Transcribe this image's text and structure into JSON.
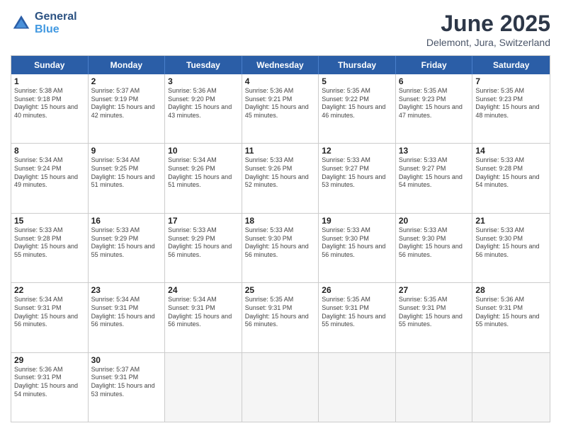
{
  "header": {
    "logo_general": "General",
    "logo_blue": "Blue",
    "month_title": "June 2025",
    "location": "Delemont, Jura, Switzerland"
  },
  "day_names": [
    "Sunday",
    "Monday",
    "Tuesday",
    "Wednesday",
    "Thursday",
    "Friday",
    "Saturday"
  ],
  "weeks": [
    [
      {
        "date": "1",
        "sunrise": "Sunrise: 5:38 AM",
        "sunset": "Sunset: 9:18 PM",
        "daylight": "Daylight: 15 hours and 40 minutes."
      },
      {
        "date": "2",
        "sunrise": "Sunrise: 5:37 AM",
        "sunset": "Sunset: 9:19 PM",
        "daylight": "Daylight: 15 hours and 42 minutes."
      },
      {
        "date": "3",
        "sunrise": "Sunrise: 5:36 AM",
        "sunset": "Sunset: 9:20 PM",
        "daylight": "Daylight: 15 hours and 43 minutes."
      },
      {
        "date": "4",
        "sunrise": "Sunrise: 5:36 AM",
        "sunset": "Sunset: 9:21 PM",
        "daylight": "Daylight: 15 hours and 45 minutes."
      },
      {
        "date": "5",
        "sunrise": "Sunrise: 5:35 AM",
        "sunset": "Sunset: 9:22 PM",
        "daylight": "Daylight: 15 hours and 46 minutes."
      },
      {
        "date": "6",
        "sunrise": "Sunrise: 5:35 AM",
        "sunset": "Sunset: 9:23 PM",
        "daylight": "Daylight: 15 hours and 47 minutes."
      },
      {
        "date": "7",
        "sunrise": "Sunrise: 5:35 AM",
        "sunset": "Sunset: 9:23 PM",
        "daylight": "Daylight: 15 hours and 48 minutes."
      }
    ],
    [
      {
        "date": "8",
        "sunrise": "Sunrise: 5:34 AM",
        "sunset": "Sunset: 9:24 PM",
        "daylight": "Daylight: 15 hours and 49 minutes."
      },
      {
        "date": "9",
        "sunrise": "Sunrise: 5:34 AM",
        "sunset": "Sunset: 9:25 PM",
        "daylight": "Daylight: 15 hours and 51 minutes."
      },
      {
        "date": "10",
        "sunrise": "Sunrise: 5:34 AM",
        "sunset": "Sunset: 9:26 PM",
        "daylight": "Daylight: 15 hours and 51 minutes."
      },
      {
        "date": "11",
        "sunrise": "Sunrise: 5:33 AM",
        "sunset": "Sunset: 9:26 PM",
        "daylight": "Daylight: 15 hours and 52 minutes."
      },
      {
        "date": "12",
        "sunrise": "Sunrise: 5:33 AM",
        "sunset": "Sunset: 9:27 PM",
        "daylight": "Daylight: 15 hours and 53 minutes."
      },
      {
        "date": "13",
        "sunrise": "Sunrise: 5:33 AM",
        "sunset": "Sunset: 9:27 PM",
        "daylight": "Daylight: 15 hours and 54 minutes."
      },
      {
        "date": "14",
        "sunrise": "Sunrise: 5:33 AM",
        "sunset": "Sunset: 9:28 PM",
        "daylight": "Daylight: 15 hours and 54 minutes."
      }
    ],
    [
      {
        "date": "15",
        "sunrise": "Sunrise: 5:33 AM",
        "sunset": "Sunset: 9:28 PM",
        "daylight": "Daylight: 15 hours and 55 minutes."
      },
      {
        "date": "16",
        "sunrise": "Sunrise: 5:33 AM",
        "sunset": "Sunset: 9:29 PM",
        "daylight": "Daylight: 15 hours and 55 minutes."
      },
      {
        "date": "17",
        "sunrise": "Sunrise: 5:33 AM",
        "sunset": "Sunset: 9:29 PM",
        "daylight": "Daylight: 15 hours and 56 minutes."
      },
      {
        "date": "18",
        "sunrise": "Sunrise: 5:33 AM",
        "sunset": "Sunset: 9:30 PM",
        "daylight": "Daylight: 15 hours and 56 minutes."
      },
      {
        "date": "19",
        "sunrise": "Sunrise: 5:33 AM",
        "sunset": "Sunset: 9:30 PM",
        "daylight": "Daylight: 15 hours and 56 minutes."
      },
      {
        "date": "20",
        "sunrise": "Sunrise: 5:33 AM",
        "sunset": "Sunset: 9:30 PM",
        "daylight": "Daylight: 15 hours and 56 minutes."
      },
      {
        "date": "21",
        "sunrise": "Sunrise: 5:33 AM",
        "sunset": "Sunset: 9:30 PM",
        "daylight": "Daylight: 15 hours and 56 minutes."
      }
    ],
    [
      {
        "date": "22",
        "sunrise": "Sunrise: 5:34 AM",
        "sunset": "Sunset: 9:31 PM",
        "daylight": "Daylight: 15 hours and 56 minutes."
      },
      {
        "date": "23",
        "sunrise": "Sunrise: 5:34 AM",
        "sunset": "Sunset: 9:31 PM",
        "daylight": "Daylight: 15 hours and 56 minutes."
      },
      {
        "date": "24",
        "sunrise": "Sunrise: 5:34 AM",
        "sunset": "Sunset: 9:31 PM",
        "daylight": "Daylight: 15 hours and 56 minutes."
      },
      {
        "date": "25",
        "sunrise": "Sunrise: 5:35 AM",
        "sunset": "Sunset: 9:31 PM",
        "daylight": "Daylight: 15 hours and 56 minutes."
      },
      {
        "date": "26",
        "sunrise": "Sunrise: 5:35 AM",
        "sunset": "Sunset: 9:31 PM",
        "daylight": "Daylight: 15 hours and 55 minutes."
      },
      {
        "date": "27",
        "sunrise": "Sunrise: 5:35 AM",
        "sunset": "Sunset: 9:31 PM",
        "daylight": "Daylight: 15 hours and 55 minutes."
      },
      {
        "date": "28",
        "sunrise": "Sunrise: 5:36 AM",
        "sunset": "Sunset: 9:31 PM",
        "daylight": "Daylight: 15 hours and 55 minutes."
      }
    ],
    [
      {
        "date": "29",
        "sunrise": "Sunrise: 5:36 AM",
        "sunset": "Sunset: 9:31 PM",
        "daylight": "Daylight: 15 hours and 54 minutes."
      },
      {
        "date": "30",
        "sunrise": "Sunrise: 5:37 AM",
        "sunset": "Sunset: 9:31 PM",
        "daylight": "Daylight: 15 hours and 53 minutes."
      },
      {
        "date": "",
        "sunrise": "",
        "sunset": "",
        "daylight": ""
      },
      {
        "date": "",
        "sunrise": "",
        "sunset": "",
        "daylight": ""
      },
      {
        "date": "",
        "sunrise": "",
        "sunset": "",
        "daylight": ""
      },
      {
        "date": "",
        "sunrise": "",
        "sunset": "",
        "daylight": ""
      },
      {
        "date": "",
        "sunrise": "",
        "sunset": "",
        "daylight": ""
      }
    ]
  ]
}
